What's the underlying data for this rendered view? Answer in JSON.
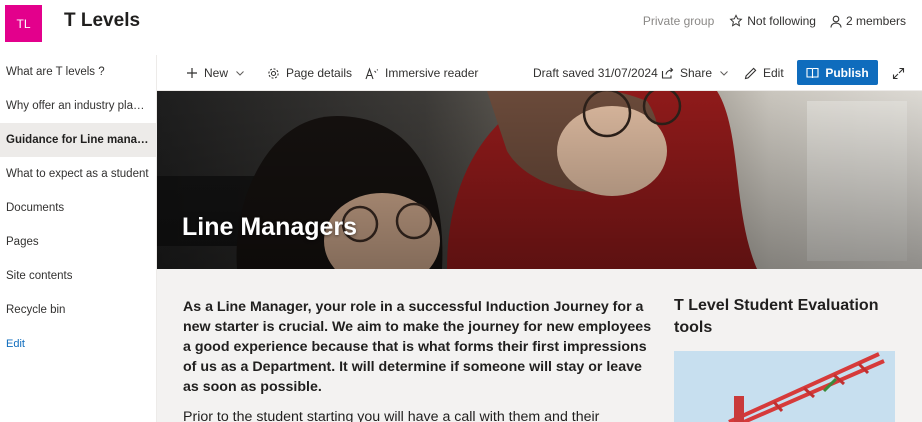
{
  "site": {
    "logo_initials": "TL",
    "title": "T Levels"
  },
  "header": {
    "private_group": "Private group",
    "follow": "Not following",
    "members": "2 members"
  },
  "nav": {
    "items": [
      {
        "label": "What are T levels ?"
      },
      {
        "label": "Why offer an industry placement?"
      },
      {
        "label": "Guidance for Line managers"
      },
      {
        "label": "What to expect as a student"
      },
      {
        "label": "Documents"
      },
      {
        "label": "Pages"
      },
      {
        "label": "Site contents"
      },
      {
        "label": "Recycle bin"
      }
    ],
    "edit": "Edit"
  },
  "commandbar": {
    "new": "New",
    "page_details": "Page details",
    "immersive_reader": "Immersive reader",
    "draft_saved": "Draft saved 31/07/2024",
    "share": "Share",
    "edit": "Edit",
    "publish": "Publish"
  },
  "hero": {
    "title": "Line Managers"
  },
  "content": {
    "paragraph1": "As a Line Manager, your role in a successful Induction Journey for a new starter is crucial. We aim to make the journey for new employees a good experience because that is what forms their first impressions of us as a Department. It will determine if someone will stay or leave as soon as possible.",
    "paragraph2": "Prior to the student starting you will have a call with them and their",
    "side_title": "T Level Student Evaluation tools"
  },
  "colors": {
    "brand": "#e3008c",
    "accent": "#0f6cbd"
  }
}
